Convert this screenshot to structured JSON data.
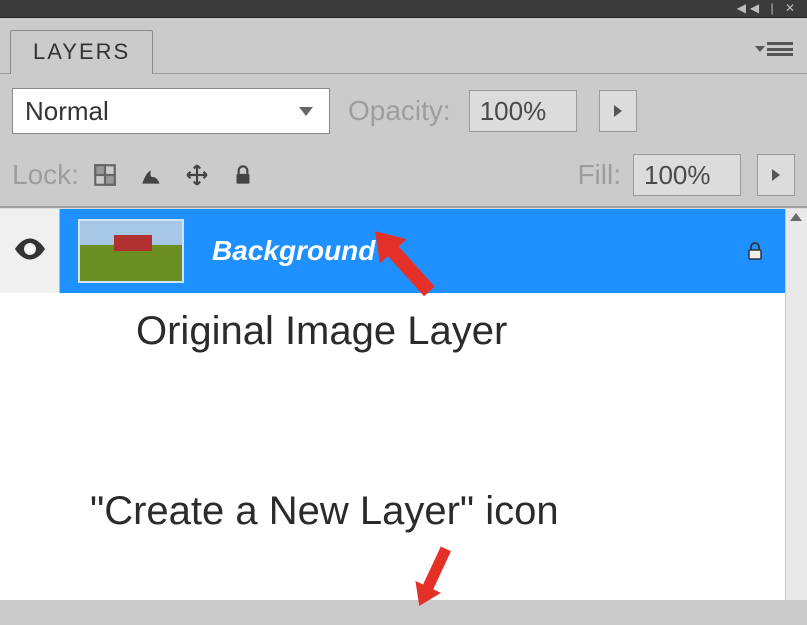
{
  "panel": {
    "tab_label": "LAYERS",
    "blend_mode": "Normal",
    "opacity_label": "Opacity:",
    "opacity_value": "100%",
    "fill_label": "Fill:",
    "fill_value": "100%",
    "lock_label": "Lock:"
  },
  "layer": {
    "name": "Background"
  },
  "annotations": {
    "line1": "Original Image Layer",
    "line2": "\"Create a New Layer\" icon"
  },
  "colors": {
    "selection": "#1e90ff",
    "arrow": "#e53027"
  }
}
